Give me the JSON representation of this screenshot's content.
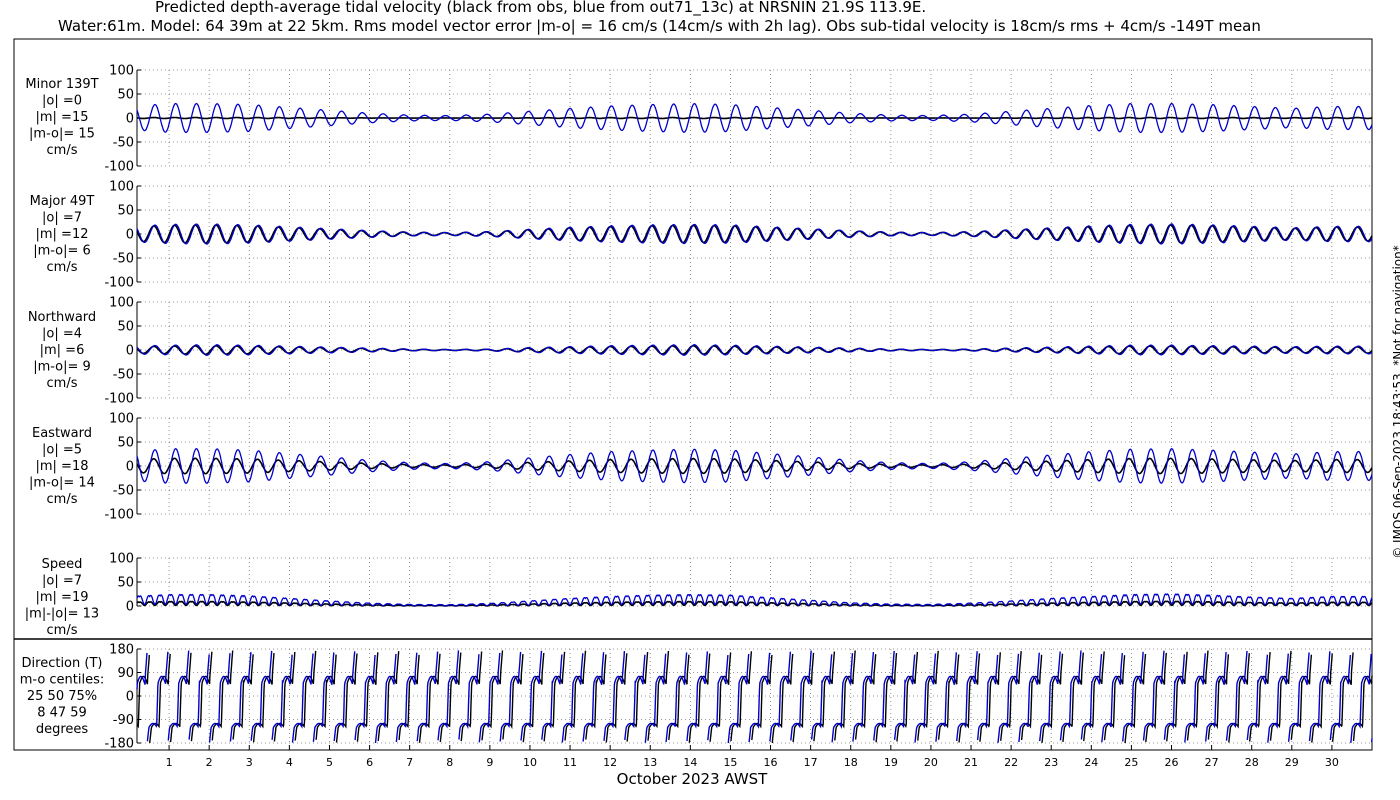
{
  "title_line1": "Predicted depth-average tidal velocity (black from obs, blue from out71_13c) at NRSNIN 21.9S 113.9E.",
  "title_line2": "Water:61m. Model: 64 39m at 22 5km. Rms model vector error |m-o| = 16 cm/s (14cm/s with 2h lag). Obs sub-tidal velocity is 18cm/s rms + 4cm/s -149T mean",
  "copyright": "© IMOS 06-Sep-2023 18:43:53. *Not for navigation*",
  "colors": {
    "obs": "#000000",
    "model": "#0000cc",
    "grid": "#777777"
  },
  "chart_data": {
    "type": "line",
    "xlabel": "October 2023 AWST",
    "x_ticks": [
      "1",
      "2",
      "3",
      "4",
      "5",
      "6",
      "7",
      "8",
      "9",
      "10",
      "11",
      "12",
      "13",
      "14",
      "15",
      "16",
      "17",
      "18",
      "19",
      "20",
      "21",
      "22",
      "23",
      "24",
      "25",
      "26",
      "27",
      "28",
      "29",
      "30"
    ],
    "xlim_days": [
      0.2,
      31.0
    ],
    "series_meaning": {
      "obs": "black from obs",
      "model": "blue from out71_13c"
    },
    "panels": [
      {
        "id": "minor",
        "labels": [
          "Minor 139T",
          "|o| =0",
          "|m| =15",
          "|m-o|= 15",
          "cm/s"
        ],
        "ylim": [
          -100,
          100
        ],
        "yticks": [
          "100",
          "50",
          "0",
          "-50",
          "-100"
        ],
        "obs_amplitude": 1,
        "model_amplitude": 30,
        "model_modulation": [
          24,
          30,
          30,
          28,
          22,
          16,
          10,
          6,
          5,
          8,
          14,
          20,
          25,
          28,
          30,
          28,
          22,
          16,
          10,
          6,
          5,
          8,
          14,
          20,
          26,
          30,
          30,
          28,
          24,
          20,
          24
        ]
      },
      {
        "id": "major",
        "labels": [
          "Major 49T",
          "|o| =7",
          "|m| =12",
          "|m-o|= 6",
          "cm/s"
        ],
        "ylim": [
          -100,
          100
        ],
        "yticks": [
          "100",
          "50",
          "0",
          "-50",
          "-100"
        ],
        "obs_amplitude": 18,
        "model_amplitude": 20,
        "model_modulation": [
          16,
          20,
          21,
          19,
          15,
          11,
          7,
          4,
          3,
          5,
          10,
          14,
          17,
          19,
          20,
          19,
          15,
          11,
          7,
          4,
          3,
          5,
          9,
          13,
          17,
          20,
          21,
          19,
          16,
          13,
          16
        ]
      },
      {
        "id": "northward",
        "labels": [
          "Northward",
          "|o| =4",
          "|m| =6",
          "|m-o|= 9",
          "cm/s"
        ],
        "ylim": [
          -100,
          100
        ],
        "yticks": [
          "100",
          "50",
          "0",
          "-50",
          "-100"
        ],
        "obs_amplitude": 8,
        "model_amplitude": 10,
        "model_modulation": [
          8,
          10,
          11,
          10,
          8,
          6,
          4,
          2,
          1,
          2,
          5,
          7,
          9,
          10,
          11,
          10,
          8,
          6,
          4,
          2,
          1,
          2,
          4,
          6,
          8,
          10,
          10,
          9,
          8,
          7,
          8
        ]
      },
      {
        "id": "eastward",
        "labels": [
          "Eastward",
          "|o| =5",
          "|m| =18",
          "|m-o|= 14",
          "cm/s"
        ],
        "ylim": [
          -100,
          100
        ],
        "yticks": [
          "100",
          "50",
          "0",
          "-50",
          "-100"
        ],
        "obs_amplitude": 16,
        "model_amplitude": 36,
        "model_modulation": [
          30,
          36,
          36,
          33,
          26,
          19,
          12,
          7,
          5,
          9,
          17,
          24,
          30,
          33,
          35,
          33,
          26,
          19,
          12,
          7,
          5,
          9,
          16,
          23,
          30,
          35,
          36,
          33,
          29,
          25,
          30
        ]
      },
      {
        "id": "speed",
        "labels": [
          "Speed",
          "|o| =7",
          "|m| =19",
          "|m|-|o|= 13",
          "cm/s"
        ],
        "ylim": [
          0,
          100
        ],
        "yticks": [
          "100",
          "50",
          "0"
        ],
        "obs_amplitude": 14,
        "model_amplitude": 36,
        "model_modulation": [
          30,
          36,
          36,
          32,
          24,
          16,
          9,
          5,
          4,
          8,
          16,
          24,
          30,
          34,
          36,
          34,
          26,
          18,
          10,
          6,
          5,
          9,
          16,
          24,
          30,
          36,
          38,
          34,
          28,
          24,
          30
        ]
      },
      {
        "id": "direction",
        "labels": [
          "Direction (T)",
          "m-o centiles:",
          "25  50  75%",
          "8  47  59",
          "degrees"
        ],
        "ylim": [
          -180,
          180
        ],
        "yticks": [
          "180",
          "90",
          "0",
          "-90",
          "-180"
        ],
        "centiles": {
          "p25": 8,
          "p50": 47,
          "p75": 59
        }
      }
    ]
  }
}
